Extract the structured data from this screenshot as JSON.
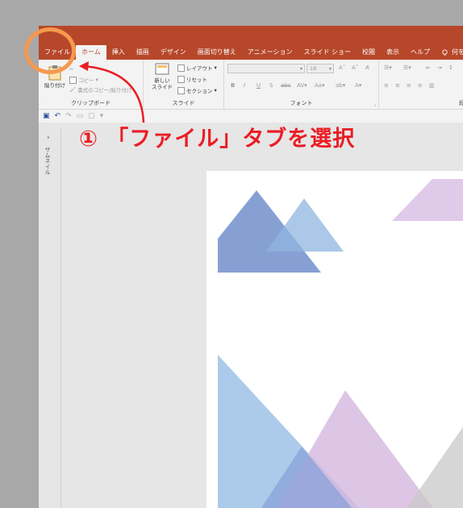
{
  "ribbon_tabs": [
    {
      "label": "ファイル"
    },
    {
      "label": "ホーム"
    },
    {
      "label": "挿入"
    },
    {
      "label": "描画"
    },
    {
      "label": "デザイン"
    },
    {
      "label": "画面切り替え"
    },
    {
      "label": "アニメーション"
    },
    {
      "label": "スライド ショー"
    },
    {
      "label": "校閲"
    },
    {
      "label": "表示"
    },
    {
      "label": "ヘルプ"
    },
    {
      "label": "何をします"
    }
  ],
  "clipboard": {
    "paste": "貼り付け",
    "cut": "",
    "copy": "コピー",
    "format_painter": "書式のコピー/貼り付け",
    "label": "クリップボード"
  },
  "slides_group": {
    "new_slide_line1": "新しい",
    "new_slide_line2": "スライド",
    "layout": "レイアウト",
    "reset": "リセット",
    "section": "セクション",
    "label": "スライド"
  },
  "font_group": {
    "font_size": "18",
    "label": "フォント"
  },
  "paragraph_group": {
    "label": "段"
  },
  "thumbnail_pane": {
    "label": "サムネイル"
  },
  "annotation": {
    "text": "① 「ファイル」タブを選択"
  },
  "colors": {
    "ribbon_red": "#b7472a",
    "annotation_red": "#ea1d24",
    "highlight_orange": "#f5994e"
  }
}
